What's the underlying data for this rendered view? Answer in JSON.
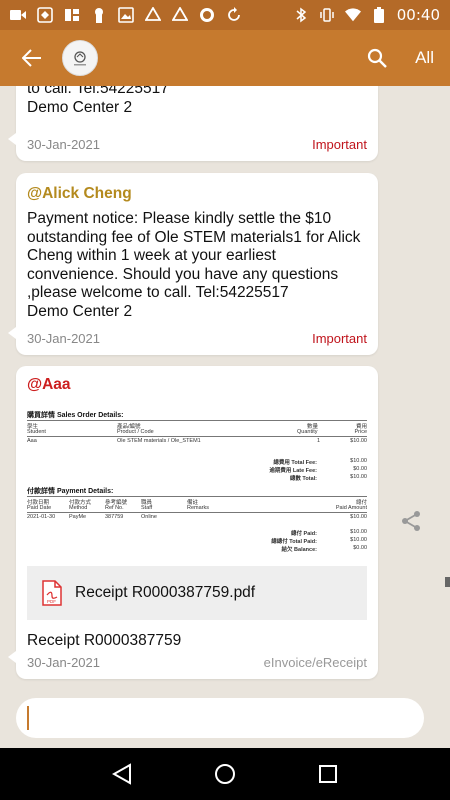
{
  "status_bar": {
    "time": "00:40",
    "left_icons": [
      "video-icon",
      "app-icon",
      "news-icon",
      "keyhole-icon",
      "image-icon",
      "drive-icon",
      "drive-icon",
      "record-icon",
      "sync-icon"
    ],
    "right_icons": [
      "bluetooth-icon",
      "vibrate-icon",
      "wifi-icon",
      "battery-icon"
    ]
  },
  "app_bar": {
    "back_icon": "arrow-left-icon",
    "search_icon": "search-icon",
    "filter_label": "All",
    "accent_color": "#c67a2e"
  },
  "messages": [
    {
      "text": "to call. Tel:54225517\nDemo Center 2",
      "date": "30-Jan-2021",
      "tag": "Important"
    },
    {
      "sender": "@Alick Cheng",
      "text": "Payment notice: Please kindly settle the $10 outstanding fee of Ole STEM materials1 for Alick Cheng within 1 week at your earliest convenience. Should you have any questions ,please welcome to call. Tel:54225517\nDemo Center 2",
      "date": "30-Jan-2021",
      "tag": "Important"
    },
    {
      "sender": "@Aaa",
      "receipt": {
        "section_sales": "購買詳情 Sales Order Details:",
        "cols_sales_zh": [
          "學生",
          "產品/編號",
          "數量",
          "費用"
        ],
        "cols_sales_en": [
          "Student",
          "Product / Code",
          "Quantity",
          "Price"
        ],
        "sales_row": [
          "Aaa",
          "Ole STEM materials / Ole_STEM1",
          "1",
          "$10.00"
        ],
        "total_fee_label": "總費用 Total Fee:",
        "total_fee": "$10.00",
        "late_fee_label": "逾期費用 Late Fee:",
        "late_fee": "$0.00",
        "total_label": "總數 Total:",
        "total": "$10.00",
        "section_payment": "付款詳情 Payment Details:",
        "cols_pay_zh": [
          "付款日期",
          "付款方式",
          "參考編號",
          "職員",
          "備註",
          "總付"
        ],
        "cols_pay_en": [
          "Paid Date",
          "Method",
          "Ref No.",
          "Staff",
          "Remarks",
          "Paid Amount"
        ],
        "pay_row": [
          "2021-01-30",
          "PayMe",
          "387759",
          "Online",
          "",
          "$10.00"
        ],
        "paid_label": "總付 Paid:",
        "paid": "$10.00",
        "total_paid_label": "總總付 Total Paid:",
        "total_paid": "$10.00",
        "balance_label": "結欠 Balance:",
        "balance": "$0.00"
      },
      "attachment": "Receipt R0000387759.pdf",
      "attachment_icon": "pdf-icon",
      "text": "Receipt R0000387759",
      "date": "30-Jan-2021",
      "tag": "eInvoice/eReceipt"
    }
  ],
  "colors": {
    "sender_alick": "#b48a1e",
    "sender_aaa": "#cc1f1f",
    "important": "#c0141c"
  },
  "input": {
    "placeholder": ""
  }
}
